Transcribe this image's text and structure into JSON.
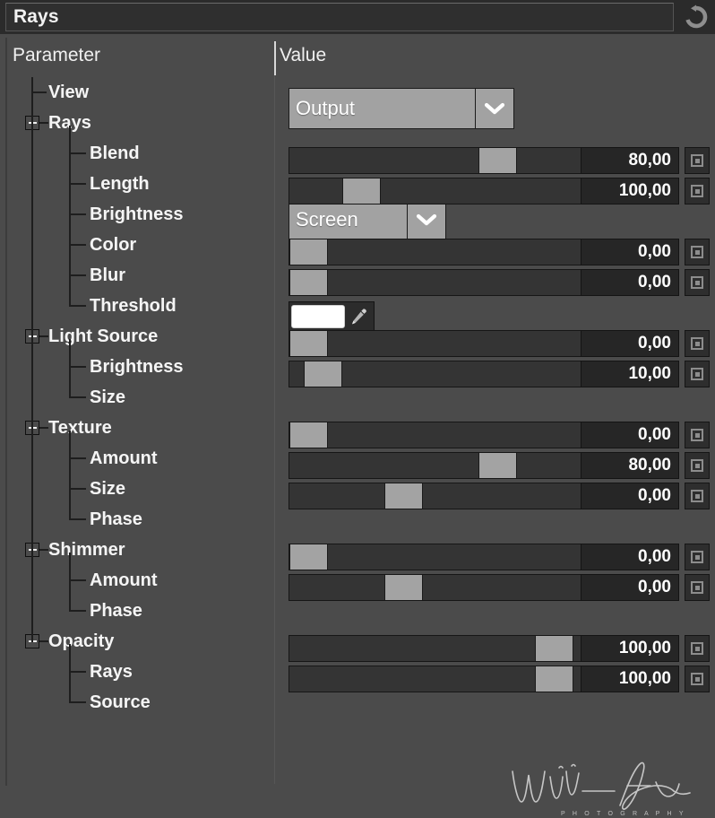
{
  "window": {
    "title": "Rays",
    "reset_all_icon": "refresh-circular-arrow-icon"
  },
  "columns": {
    "parameter_header": "Parameter",
    "value_header": "Value"
  },
  "tree": [
    {
      "label": "View",
      "depth": 1,
      "expander": false
    },
    {
      "label": "Rays",
      "depth": 1,
      "expander": true
    },
    {
      "label": "Blend",
      "depth": 2,
      "expander": false
    },
    {
      "label": "Length",
      "depth": 2,
      "expander": false
    },
    {
      "label": "Brightness",
      "depth": 2,
      "expander": false
    },
    {
      "label": "Color",
      "depth": 2,
      "expander": false
    },
    {
      "label": "Blur",
      "depth": 2,
      "expander": false
    },
    {
      "label": "Threshold",
      "depth": 2,
      "expander": false
    },
    {
      "label": "Light Source",
      "depth": 1,
      "expander": true
    },
    {
      "label": "Brightness",
      "depth": 2,
      "expander": false
    },
    {
      "label": "Size",
      "depth": 2,
      "expander": false
    },
    {
      "label": "Texture",
      "depth": 1,
      "expander": true
    },
    {
      "label": "Amount",
      "depth": 2,
      "expander": false
    },
    {
      "label": "Size",
      "depth": 2,
      "expander": false
    },
    {
      "label": "Phase",
      "depth": 2,
      "expander": false
    },
    {
      "label": "Shimmer",
      "depth": 1,
      "expander": true
    },
    {
      "label": "Amount",
      "depth": 2,
      "expander": false
    },
    {
      "label": "Phase",
      "depth": 2,
      "expander": false
    },
    {
      "label": "Opacity",
      "depth": 1,
      "expander": true
    },
    {
      "label": "Rays",
      "depth": 2,
      "expander": false
    },
    {
      "label": "Source",
      "depth": 2,
      "expander": false
    }
  ],
  "controls": {
    "view_dropdown": {
      "value": "Output",
      "arrow_icon": "chevron-down-icon"
    },
    "blend_dropdown": {
      "value": "Screen",
      "arrow_icon": "chevron-down-icon"
    },
    "color": {
      "swatch_hex": "#ffffff",
      "picker_icon": "eyedropper-icon"
    },
    "sliders": [
      {
        "param": "rays-length",
        "value": "80,00",
        "fill_pct": 54,
        "reset_icon": "reset-square-icon"
      },
      {
        "param": "rays-brightness",
        "value": "100,00",
        "fill_pct": 15,
        "reset_icon": "reset-square-icon"
      },
      {
        "param": "rays-blur",
        "value": "0,00",
        "fill_pct": 0,
        "reset_icon": "reset-square-icon"
      },
      {
        "param": "rays-threshold",
        "value": "0,00",
        "fill_pct": 0,
        "reset_icon": "reset-square-icon"
      },
      {
        "param": "light-source-brightness",
        "value": "0,00",
        "fill_pct": 0,
        "reset_icon": "reset-square-icon"
      },
      {
        "param": "light-source-size",
        "value": "10,00",
        "fill_pct": 4,
        "reset_icon": "reset-square-icon"
      },
      {
        "param": "texture-amount",
        "value": "0,00",
        "fill_pct": 0,
        "reset_icon": "reset-square-icon"
      },
      {
        "param": "texture-size",
        "value": "80,00",
        "fill_pct": 54,
        "reset_icon": "reset-square-icon"
      },
      {
        "param": "texture-phase",
        "value": "0,00",
        "fill_pct": 27,
        "reset_icon": "reset-square-icon"
      },
      {
        "param": "shimmer-amount",
        "value": "0,00",
        "fill_pct": 0,
        "reset_icon": "reset-square-icon"
      },
      {
        "param": "shimmer-phase",
        "value": "0,00",
        "fill_pct": 27,
        "reset_icon": "reset-square-icon"
      },
      {
        "param": "opacity-rays",
        "value": "100,00",
        "fill_pct": 70,
        "reset_icon": "reset-square-icon"
      },
      {
        "param": "opacity-source",
        "value": "100,00",
        "fill_pct": 70,
        "reset_icon": "reset-square-icon"
      }
    ]
  },
  "watermark": {
    "name": "Wim Arys",
    "subtitle": "P H O T O G R A P H Y"
  },
  "colors": {
    "panel_bg": "#4b4b4b",
    "titlebar_bg": "#2b2b2b",
    "dropdown_face": "#a2a2a2",
    "slider_thumb": "#a3a3a3",
    "slider_track": "#343434",
    "numbox_bg": "#262626",
    "text": "#f5f5f5"
  }
}
